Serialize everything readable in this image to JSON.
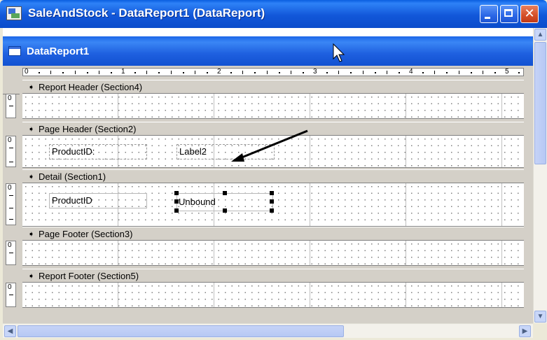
{
  "window": {
    "title": "SaleAndStock - DataReport1 (DataReport)"
  },
  "report": {
    "title": "DataReport1"
  },
  "ruler": {
    "marks": [
      "0",
      "1",
      "2",
      "3",
      "4",
      "5"
    ]
  },
  "sections": [
    {
      "label": "Report Header (Section4)"
    },
    {
      "label": "Page Header (Section2)"
    },
    {
      "label": "Detail (Section1)"
    },
    {
      "label": "Page Footer (Section3)"
    },
    {
      "label": "Report Footer (Section5)"
    }
  ],
  "side_ruler": {
    "zero": "0"
  },
  "controls": {
    "page_header_label1": "ProductID:",
    "page_header_label2": "Label2",
    "detail_textbox1": "ProductID",
    "detail_textbox2": "Unbound"
  },
  "icons": {
    "band_arrow": "section-collapse-arrow-icon",
    "cursor": "mouse-pointer-icon"
  },
  "colors": {
    "accent": "#0A4CCB",
    "arrow": "#000000"
  }
}
